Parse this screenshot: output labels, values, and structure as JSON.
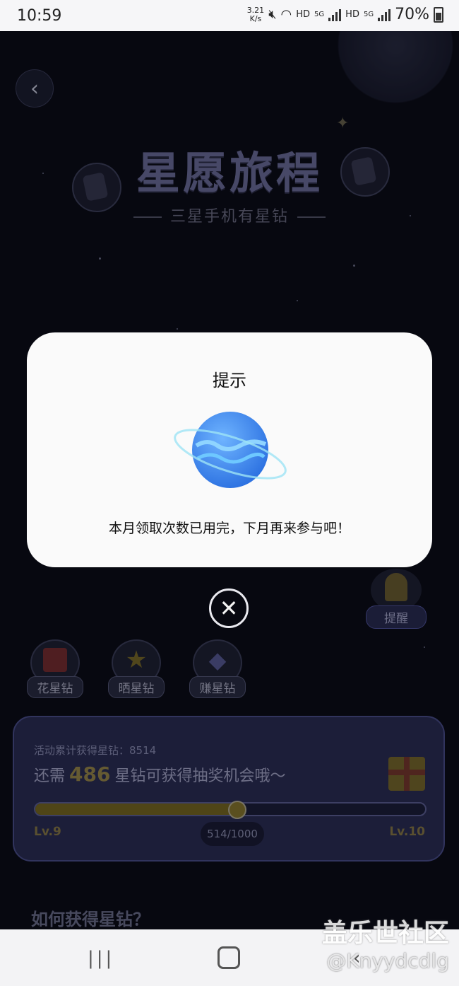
{
  "status_bar": {
    "time": "10:59",
    "speed_value": "3.21",
    "speed_unit": "K/s",
    "hd_1": "HD",
    "net_1": "5G",
    "hd_2": "HD",
    "net_2": "5G",
    "battery": "70%"
  },
  "header": {
    "title": "星愿旅程",
    "subtitle": "三星手机有星钻"
  },
  "remind": {
    "label": "提醒"
  },
  "quick_actions": [
    {
      "label": "花星钻",
      "icon": "shopping-bag-icon"
    },
    {
      "label": "晒星钻",
      "icon": "star-icon"
    },
    {
      "label": "赚星钻",
      "icon": "diamond-icon"
    }
  ],
  "progress": {
    "accumulated_label": "活动累计获得星钻：",
    "accumulated_value": "8514",
    "need_prefix": "还需",
    "need_value": "486",
    "need_suffix": "星钻可获得抽奖机会哦～",
    "current_level": "Lv.9",
    "next_level": "Lv.10",
    "count_text": "514/1000",
    "fraction": 0.514
  },
  "how_title": "如何获得星钻？",
  "modal": {
    "title": "提示",
    "message": "本月领取次数已用完，下月再来参与吧！",
    "icon": "planet-icon"
  },
  "watermark": {
    "line1": "盖乐世社区",
    "line2": "@Knyydcdlg"
  },
  "colors": {
    "background": "#0c0d1a",
    "modal_bg": "#fafafa",
    "progress_fill": "#7a6a24",
    "card_bg": "#2c2e58"
  }
}
